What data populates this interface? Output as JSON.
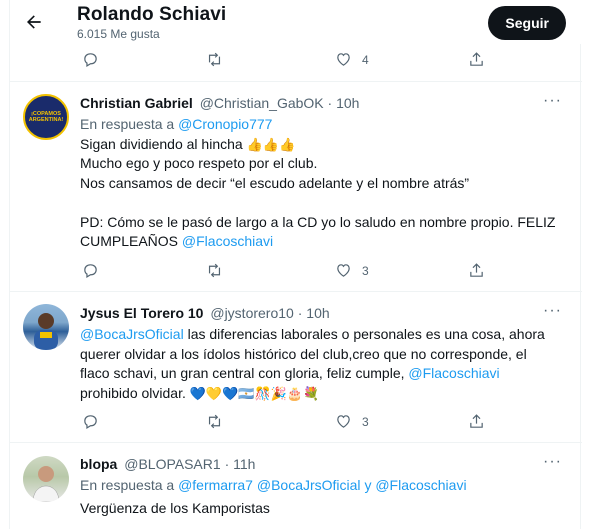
{
  "header": {
    "title": "Rolando Schiavi",
    "subtitle": "6.015 Me gusta",
    "follow_label": "Seguir"
  },
  "top_actions": {
    "reply": "",
    "retweet": "",
    "like": "4"
  },
  "tweets": [
    {
      "name": "Christian Gabriel",
      "handle": "@Christian_GabOK",
      "sep": "·",
      "time": "10h",
      "reply_prefix": "En respuesta a",
      "reply_to": "@Cronopio777",
      "line1": "Sigan dividiendo al hincha",
      "line1_emoji": "👍👍👍",
      "line2": "Mucho ego y poco respeto por el club.",
      "line3": "Nos cansamos de decir “el escudo adelante y el nombre atrás”",
      "line4": "PD: Cómo se le pasó de largo a la CD yo lo saludo en nombre propio. FELIZ",
      "line5": "CUMPLEAÑOS",
      "mention": "@Flacoschiavi",
      "likes": "3",
      "avatar_text": "¡COPAMOS ARGENTINA!"
    },
    {
      "name": "Jysus El Torero 10",
      "handle": "@jystorero10",
      "sep": "·",
      "time": "10h",
      "mention1": "@BocaJrsOficial",
      "line1": "las diferencias laborales o personales es una cosa, ahora",
      "line2": "querer olvidar a los ídolos histórico del club,creo que no corresponde, el",
      "line3": "flaco schavi, un gran central con gloria, feliz cumple,",
      "mention2": "@Flacoschiavi",
      "line4": "prohibido olvidar.",
      "emoji": "💙💛💙🇦🇷🎊🎉🎂💐",
      "likes": "3"
    },
    {
      "name": "blopa",
      "handle": "@BLOPASAR1",
      "sep": "·",
      "time": "11h",
      "reply_prefix": "En respuesta a",
      "reply_to1": "@fermarra7",
      "reply_to2": "@BocaJrsOficial",
      "and_word": "y",
      "reply_to3": "@Flacoschiavi",
      "line1": "Vergüenza de los Kamporistas"
    }
  ],
  "more_label": "···",
  "colors": {
    "link": "#1d9bf0",
    "muted": "#536471",
    "text": "#0f1419",
    "button": "#0f1419"
  },
  "icons": [
    "back-arrow-icon",
    "reply-icon",
    "retweet-icon",
    "like-icon",
    "share-icon",
    "more-icon"
  ]
}
